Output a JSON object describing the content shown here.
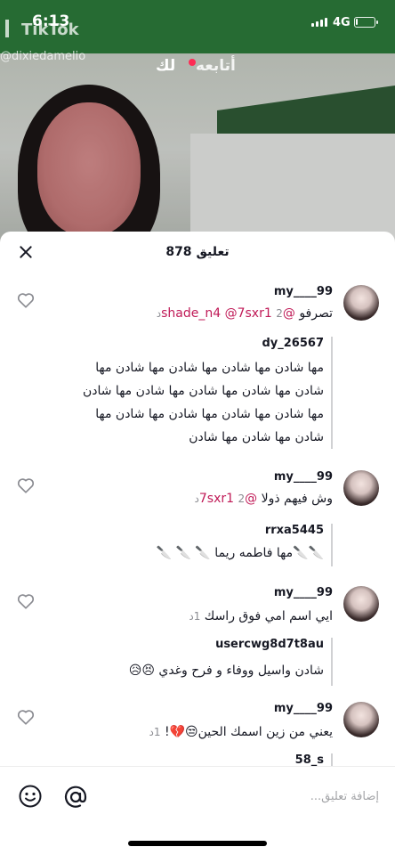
{
  "status_bar": {
    "time": "6:13",
    "network": "4G",
    "battery_level": 0.1
  },
  "video": {
    "watermark_brand": "TikTok",
    "watermark_user": "@dixiedamelio"
  },
  "top_tabs": {
    "following": "أتابعه",
    "for_you": "لك"
  },
  "comments_sheet": {
    "title": "878 تعليق",
    "comments": [
      {
        "username": "my____99",
        "time": "2د",
        "text": "تصرفو",
        "mentions": [
          "@shade_n4",
          "@7sxr1"
        ],
        "reply": {
          "username": "dy_26567",
          "lines": [
            "مها شادن مها شادن مها شادن مها شادن مها",
            "شادن مها شادن مها شادن مها شادن مها شادن",
            "مها شادن مها شادن مها شادن مها شادن مها",
            "شادن مها شادن مها شادن"
          ]
        }
      },
      {
        "username": "my____99",
        "time": "2د",
        "text": "وش فيهم ذولا",
        "mentions": [
          "@7sxr1"
        ],
        "reply": {
          "username": "rrxa5445",
          "lines": [
            "🔪🔪مها فاطمه ريما 🔪 🔪 🔪"
          ]
        }
      },
      {
        "username": "my____99",
        "time": "1د",
        "text": "ايي اسم امي فوق راسك",
        "mentions": [],
        "reply": {
          "username": "usercwg8d7t8au",
          "lines": [
            "شادن واسيل ووفاء و فرح وغدي 😣😥"
          ]
        }
      },
      {
        "username": "my____99",
        "time": "1د",
        "text": "يعني من زين اسمك الحين😒💔!",
        "mentions": [],
        "reply": {
          "username": "58_s",
          "lines": []
        }
      }
    ]
  },
  "input_bar": {
    "placeholder": "إضافة تعليق..."
  },
  "colors": {
    "mention": "#c01a57",
    "accent_red": "#fe2c55",
    "muted": "#8a8b91"
  }
}
